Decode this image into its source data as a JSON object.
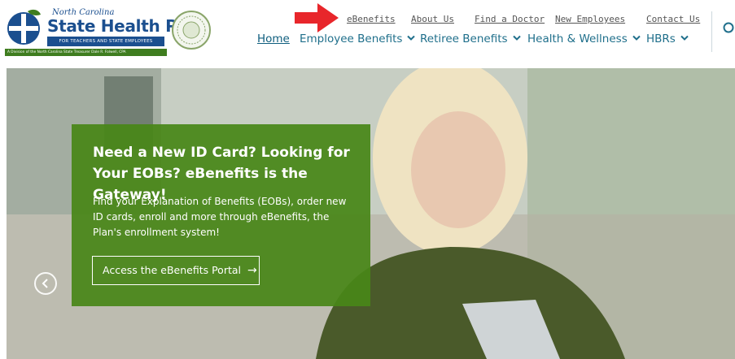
{
  "logo": {
    "line1": "North Carolina",
    "line2": "State Health Plan",
    "line3": "FOR TEACHERS AND STATE EMPLOYEES",
    "line4": "A Division of the North Carolina State Treasurer Dale R. Folwell, CPA"
  },
  "utility_nav": [
    "eBenefits",
    "About Us",
    "Find a Doctor",
    "New Employees",
    "Contact Us"
  ],
  "main_nav": {
    "home": "Home",
    "items": [
      "Employee Benefits",
      "Retiree Benefits",
      "Health & Wellness",
      "HBRs"
    ]
  },
  "promo": {
    "title": "Need a New ID Card? Looking for Your EOBs? eBenefits is the Gateway!",
    "body": "Find your Explanation of Benefits (EOBs), order new ID cards, enroll and more through eBenefits, the Plan's enrollment system!",
    "cta": "Access the eBenefits Portal",
    "cta_arrow": "→"
  },
  "colors": {
    "brand_blue": "#1b4f8f",
    "nav_teal": "#1f6f8b",
    "promo_green": "#488618",
    "annotation_red": "#e8262b"
  },
  "icons": [
    "logo-mark-icon",
    "state-seal-icon",
    "red-arrow-annotation-icon",
    "chevron-down-icon",
    "search-icon",
    "carousel-prev-icon",
    "arrow-right-icon"
  ]
}
